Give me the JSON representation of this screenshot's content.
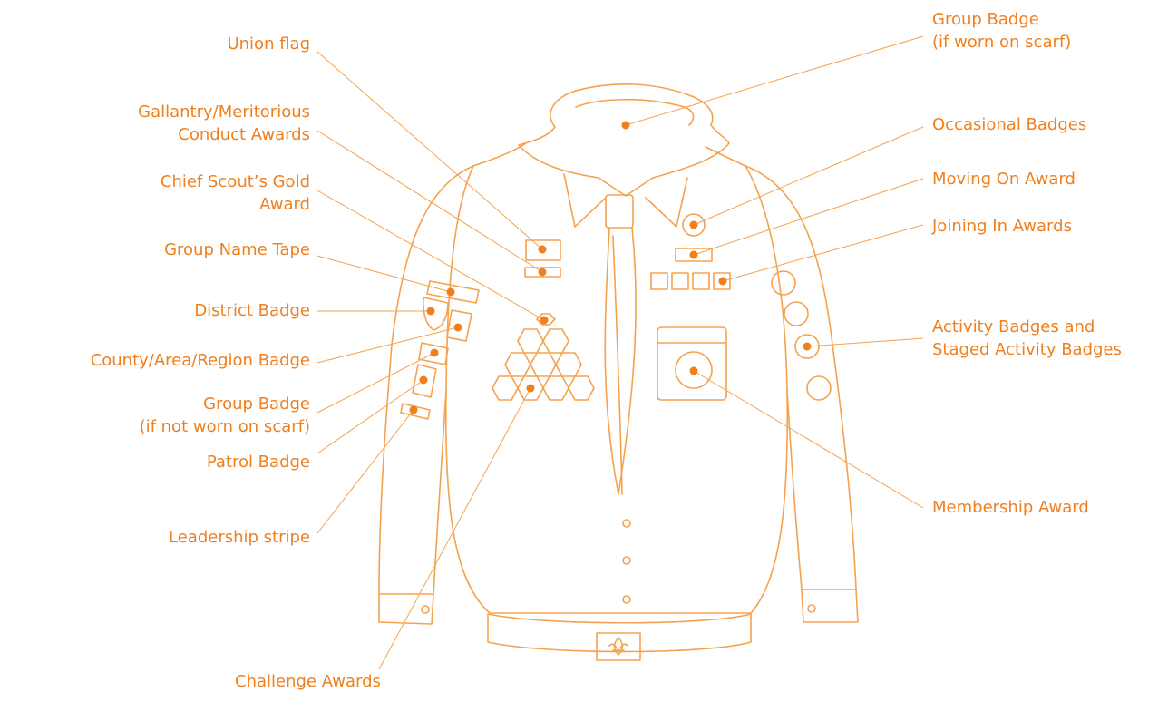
{
  "labels": {
    "union_flag": [
      "Union flag"
    ],
    "gallantry": [
      "Gallantry/Meritorious",
      "Conduct Awards"
    ],
    "chief_scout": [
      "Chief Scout’s Gold",
      "Award"
    ],
    "group_name_tape": [
      "Group Name Tape"
    ],
    "district_badge": [
      "District Badge"
    ],
    "county_badge": [
      "County/Area/Region Badge"
    ],
    "group_badge_not_scarf": [
      "Group Badge",
      "(if not worn on scarf)"
    ],
    "patrol_badge": [
      "Patrol Badge"
    ],
    "leadership_stripe": [
      "Leadership stripe"
    ],
    "challenge_awards": [
      "Challenge Awards"
    ],
    "group_badge_scarf": [
      "Group Badge",
      "(if worn on scarf)"
    ],
    "occasional_badges": [
      "Occasional Badges"
    ],
    "moving_on_award": [
      "Moving On Award"
    ],
    "joining_in_awards": [
      "Joining In Awards"
    ],
    "activity_badges": [
      "Activity Badges and",
      "Staged Activity Badges"
    ],
    "membership_award": [
      "Membership Award"
    ]
  },
  "colors": {
    "label_text": "#f07f1e",
    "outline": "#f5a24e",
    "marker_dot": "#f07f1e"
  },
  "icons": {
    "belt_buckle": "fleur-de-lis-icon"
  }
}
